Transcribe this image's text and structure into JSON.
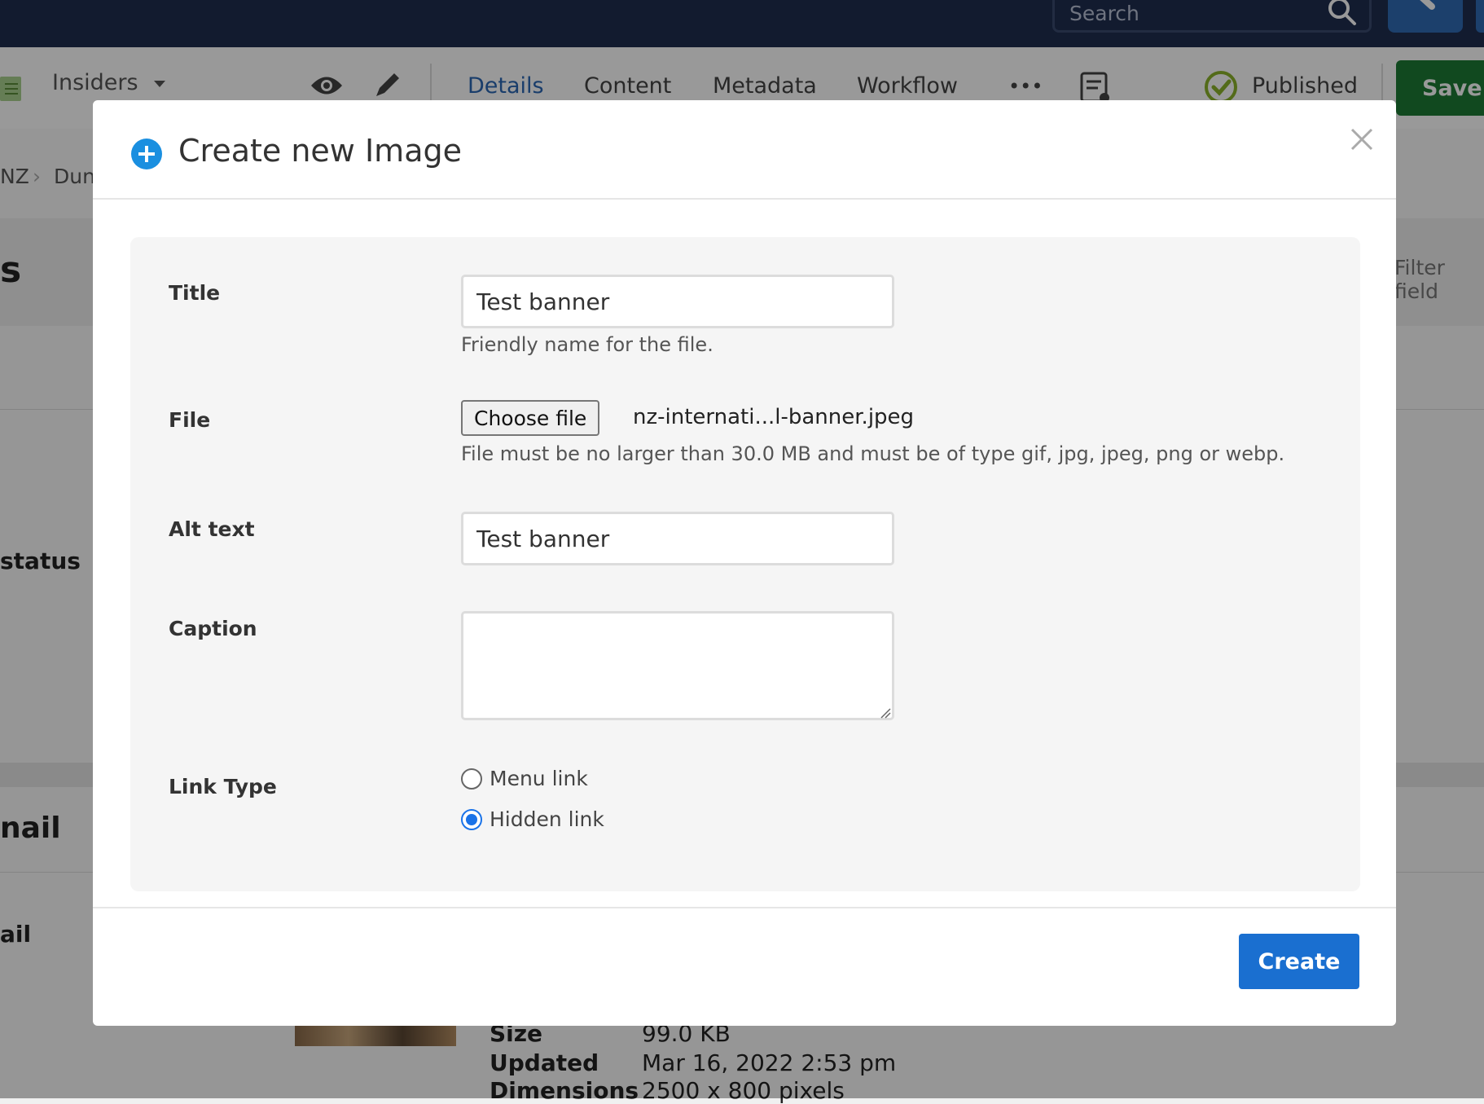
{
  "header": {
    "search_placeholder": "Search"
  },
  "toolbar": {
    "site": "Insiders",
    "tabs": [
      {
        "label": "Details",
        "active": true
      },
      {
        "label": "Content",
        "active": false
      },
      {
        "label": "Metadata",
        "active": false
      },
      {
        "label": "Workflow",
        "active": false
      }
    ],
    "more": "•••",
    "status": "Published",
    "save_label": "Save"
  },
  "background": {
    "breadcrumb": "NZ",
    "breadcrumb_next": "Dun",
    "heading_fragment": "s",
    "filter_fragment": "Filter field",
    "status_fragment": "status",
    "thumbnail_fragment": "nail",
    "thumbnail_fragment2": "ail",
    "details": [
      {
        "key": "Size",
        "value": "99.0 KB"
      },
      {
        "key": "Updated",
        "value": "Mar 16, 2022 2:53 pm"
      },
      {
        "key": "Dimensions",
        "value": "2500 x 800 pixels"
      }
    ]
  },
  "modal": {
    "title": "Create new Image",
    "fields": {
      "title_label": "Title",
      "title_value": "Test banner",
      "title_help": "Friendly name for the file.",
      "file_label": "File",
      "file_button": "Choose file",
      "file_name": "nz-internati...l-banner.jpeg",
      "file_help": "File must be no larger than 30.0 MB and must be of type gif, jpg, jpeg, png or webp.",
      "alt_label": "Alt text",
      "alt_value": "Test banner",
      "caption_label": "Caption",
      "caption_value": "",
      "link_type_label": "Link Type",
      "link_options": [
        {
          "label": "Menu link",
          "checked": false
        },
        {
          "label": "Hidden link",
          "checked": true
        }
      ]
    },
    "create_label": "Create"
  },
  "colors": {
    "topbar": "#1e2d4f",
    "accent": "#1a6fd0",
    "save": "#1d7a34",
    "published": "#8ab22b"
  }
}
